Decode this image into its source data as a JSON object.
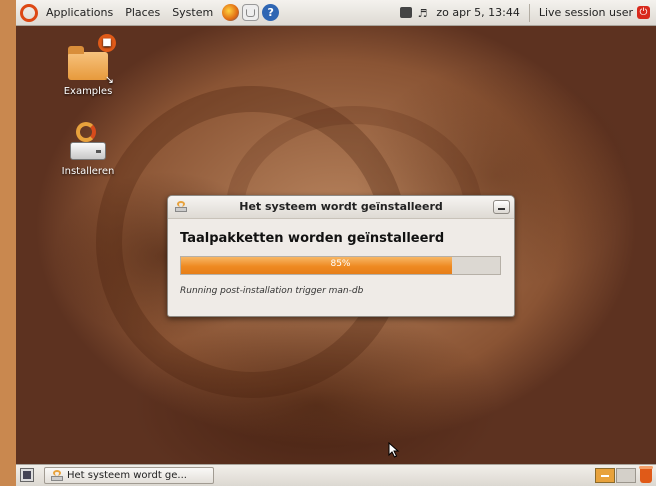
{
  "top_panel": {
    "menus": [
      "Applications",
      "Places",
      "System"
    ],
    "clock": "zo apr  5, 13:44",
    "user": "Live session user"
  },
  "desktop_icons": [
    {
      "label": "Examples"
    },
    {
      "label": "Installeren"
    }
  ],
  "dialog": {
    "title": "Het systeem wordt geïnstalleerd",
    "heading": "Taalpakketten worden geïnstalleerd",
    "progress_value": 85,
    "progress_label": "85%",
    "status": "Running post-installation trigger man-db"
  },
  "taskbar": {
    "task_label": "Het systeem wordt ge..."
  },
  "colors": {
    "accent": "#ee8a22",
    "panel": "#e8e5e0"
  }
}
